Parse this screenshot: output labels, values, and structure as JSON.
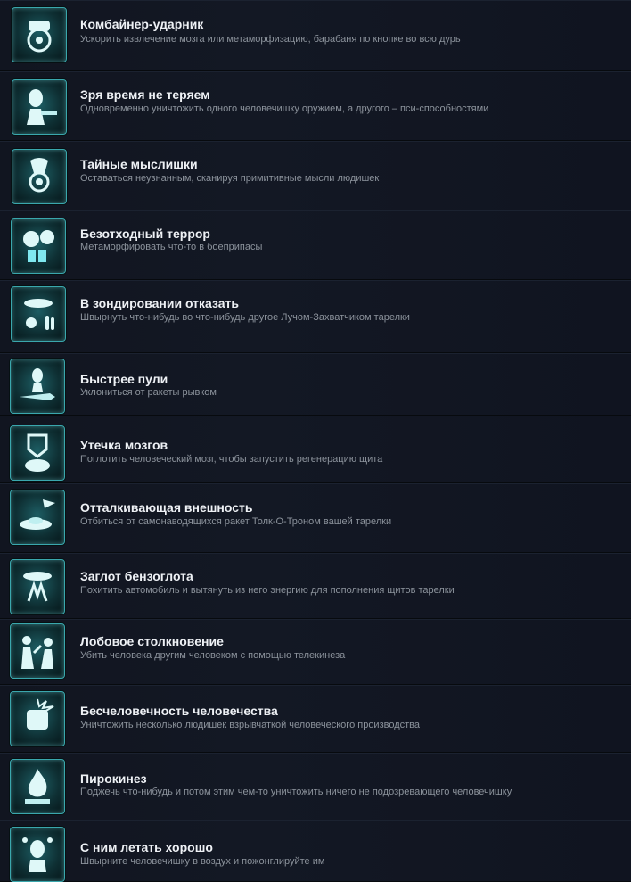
{
  "achievements": [
    {
      "title": "Комбайнер-ударник",
      "description": "Ускорить извлечение мозга или метаморфизацию, барабаня по кнопке во всю дурь",
      "icon": "tractor-icon"
    },
    {
      "title": "Зря время не теряем",
      "description": "Одновременно уничтожить одного человечишку оружием, а другого – пси-способностями",
      "icon": "alien-weapon-icon"
    },
    {
      "title": "Тайные мыслишки",
      "description": "Оставаться неузнанным, сканируя примитивные мысли людишек",
      "icon": "mind-eye-icon"
    },
    {
      "title": "Безотходный террор",
      "description": "Метаморфировать что-то в боеприпасы",
      "icon": "ammo-barrels-icon"
    },
    {
      "title": "В зондировании отказать",
      "description": "Швырнуть что-нибудь во что-нибудь другое Лучом-Захватчиком тарелки",
      "icon": "ufo-bowling-icon"
    },
    {
      "title": "Быстрее пули",
      "description": "Уклониться от ракеты рывком",
      "icon": "alien-rocket-icon"
    },
    {
      "title": "Утечка мозгов",
      "description": "Поглотить человеческий мозг, чтобы запустить регенерацию щита",
      "icon": "brain-shield-icon"
    },
    {
      "title": "Отталкивающая внешность",
      "description": "Отбиться от самонаводящихся ракет Толк-О-Троном вашей тарелки",
      "icon": "ufo-missile-icon"
    },
    {
      "title": "Заглот бензоглота",
      "description": "Похитить автомобиль и вытянуть из него энергию для пополнения щитов тарелки",
      "icon": "ufo-energy-icon"
    },
    {
      "title": "Лобовое столкновение",
      "description": "Убить человека другим человеком с помощью телекинеза",
      "icon": "human-collision-icon"
    },
    {
      "title": "Бесчеловечность человечества",
      "description": "Уничтожить несколько людишек взрывчаткой человеческого производства",
      "icon": "explosive-icon"
    },
    {
      "title": "Пирокинез",
      "description": "Поджечь что-нибудь и потом этим чем-то уничтожить ничего не подозревающего человечишку",
      "icon": "fire-icon"
    },
    {
      "title": "С ним летать хорошо",
      "description": "Швырните человечишку в воздух и пожонглируйте им",
      "icon": "alien-juggle-icon"
    }
  ]
}
